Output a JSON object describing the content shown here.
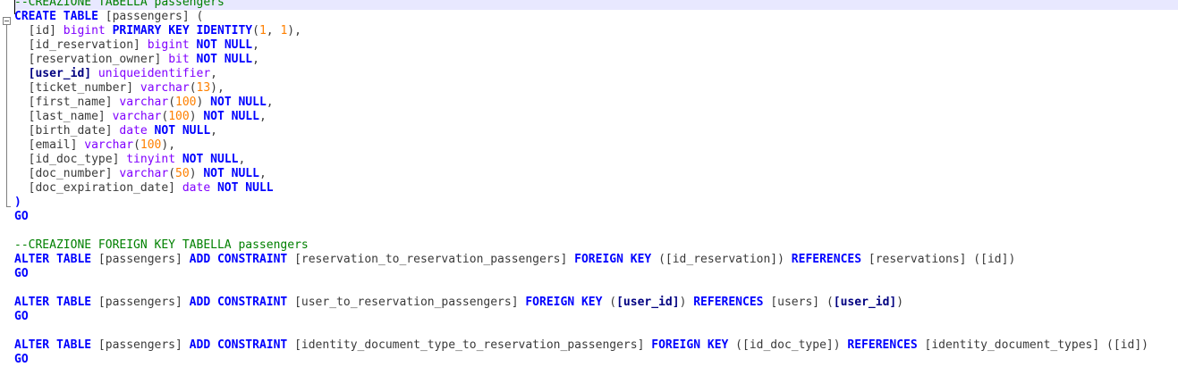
{
  "editor": {
    "colors": {
      "keyword": "#0000ff",
      "type": "#8000ff",
      "number": "#ff8000",
      "comment": "#008000",
      "identifier_bold": "#000080",
      "current_line": "#e8e8ff"
    },
    "lines": [
      [
        {
          "t": "cmt",
          "v": "--CREAZIONE TABELLA passengers"
        }
      ],
      [
        {
          "t": "kw",
          "v": "CREATE TABLE"
        },
        {
          "t": "pl",
          "v": " [passengers] ("
        }
      ],
      [
        {
          "t": "pl",
          "v": "  [id] "
        },
        {
          "t": "ty",
          "v": "bigint"
        },
        {
          "t": "pl",
          "v": " "
        },
        {
          "t": "kw",
          "v": "PRIMARY KEY IDENTITY"
        },
        {
          "t": "pl",
          "v": "("
        },
        {
          "t": "num",
          "v": "1"
        },
        {
          "t": "pl",
          "v": ", "
        },
        {
          "t": "num",
          "v": "1"
        },
        {
          "t": "pl",
          "v": "),"
        }
      ],
      [
        {
          "t": "pl",
          "v": "  [id_reservation] "
        },
        {
          "t": "ty",
          "v": "bigint"
        },
        {
          "t": "pl",
          "v": " "
        },
        {
          "t": "kw",
          "v": "NOT NULL"
        },
        {
          "t": "pl",
          "v": ","
        }
      ],
      [
        {
          "t": "pl",
          "v": "  [reservation_owner] "
        },
        {
          "t": "ty",
          "v": "bit"
        },
        {
          "t": "pl",
          "v": " "
        },
        {
          "t": "kw",
          "v": "NOT NULL"
        },
        {
          "t": "pl",
          "v": ","
        }
      ],
      [
        {
          "t": "id",
          "v": "  [user_id]"
        },
        {
          "t": "pl",
          "v": " "
        },
        {
          "t": "ty",
          "v": "uniqueidentifier"
        },
        {
          "t": "pl",
          "v": ","
        }
      ],
      [
        {
          "t": "pl",
          "v": "  [ticket_number] "
        },
        {
          "t": "ty",
          "v": "varchar"
        },
        {
          "t": "pl",
          "v": "("
        },
        {
          "t": "num",
          "v": "13"
        },
        {
          "t": "pl",
          "v": "),"
        }
      ],
      [
        {
          "t": "pl",
          "v": "  [first_name] "
        },
        {
          "t": "ty",
          "v": "varchar"
        },
        {
          "t": "pl",
          "v": "("
        },
        {
          "t": "num",
          "v": "100"
        },
        {
          "t": "pl",
          "v": ") "
        },
        {
          "t": "kw",
          "v": "NOT NULL"
        },
        {
          "t": "pl",
          "v": ","
        }
      ],
      [
        {
          "t": "pl",
          "v": "  [last_name] "
        },
        {
          "t": "ty",
          "v": "varchar"
        },
        {
          "t": "pl",
          "v": "("
        },
        {
          "t": "num",
          "v": "100"
        },
        {
          "t": "pl",
          "v": ") "
        },
        {
          "t": "kw",
          "v": "NOT NULL"
        },
        {
          "t": "pl",
          "v": ","
        }
      ],
      [
        {
          "t": "pl",
          "v": "  [birth_date] "
        },
        {
          "t": "ty",
          "v": "date"
        },
        {
          "t": "pl",
          "v": " "
        },
        {
          "t": "kw",
          "v": "NOT NULL"
        },
        {
          "t": "pl",
          "v": ","
        }
      ],
      [
        {
          "t": "pl",
          "v": "  [email] "
        },
        {
          "t": "ty",
          "v": "varchar"
        },
        {
          "t": "pl",
          "v": "("
        },
        {
          "t": "num",
          "v": "100"
        },
        {
          "t": "pl",
          "v": "),"
        }
      ],
      [
        {
          "t": "pl",
          "v": "  [id_doc_type] "
        },
        {
          "t": "ty",
          "v": "tinyint"
        },
        {
          "t": "pl",
          "v": " "
        },
        {
          "t": "kw",
          "v": "NOT NULL"
        },
        {
          "t": "pl",
          "v": ","
        }
      ],
      [
        {
          "t": "pl",
          "v": "  [doc_number] "
        },
        {
          "t": "ty",
          "v": "varchar"
        },
        {
          "t": "pl",
          "v": "("
        },
        {
          "t": "num",
          "v": "50"
        },
        {
          "t": "pl",
          "v": ") "
        },
        {
          "t": "kw",
          "v": "NOT NULL"
        },
        {
          "t": "pl",
          "v": ","
        }
      ],
      [
        {
          "t": "pl",
          "v": "  [doc_expiration_date] "
        },
        {
          "t": "ty",
          "v": "date"
        },
        {
          "t": "pl",
          "v": " "
        },
        {
          "t": "kw",
          "v": "NOT NULL"
        }
      ],
      [
        {
          "t": "kw",
          "v": ")"
        }
      ],
      [
        {
          "t": "kw",
          "v": "GO"
        }
      ],
      [],
      [
        {
          "t": "cmt",
          "v": "--CREAZIONE FOREIGN KEY TABELLA passengers"
        }
      ],
      [
        {
          "t": "kw",
          "v": "ALTER TABLE"
        },
        {
          "t": "pl",
          "v": " [passengers] "
        },
        {
          "t": "kw",
          "v": "ADD CONSTRAINT"
        },
        {
          "t": "pl",
          "v": " [reservation_to_reservation_passengers] "
        },
        {
          "t": "kw",
          "v": "FOREIGN KEY"
        },
        {
          "t": "pl",
          "v": " ([id_reservation]) "
        },
        {
          "t": "kw",
          "v": "REFERENCES"
        },
        {
          "t": "pl",
          "v": " [reservations] ([id])"
        }
      ],
      [
        {
          "t": "kw",
          "v": "GO"
        }
      ],
      [],
      [
        {
          "t": "kw",
          "v": "ALTER TABLE"
        },
        {
          "t": "pl",
          "v": " [passengers] "
        },
        {
          "t": "kw",
          "v": "ADD CONSTRAINT"
        },
        {
          "t": "pl",
          "v": " [user_to_reservation_passengers] "
        },
        {
          "t": "kw",
          "v": "FOREIGN KEY"
        },
        {
          "t": "pl",
          "v": " ("
        },
        {
          "t": "id",
          "v": "[user_id]"
        },
        {
          "t": "pl",
          "v": ") "
        },
        {
          "t": "kw",
          "v": "REFERENCES"
        },
        {
          "t": "pl",
          "v": " [users] ("
        },
        {
          "t": "id",
          "v": "[user_id]"
        },
        {
          "t": "pl",
          "v": ")"
        }
      ],
      [
        {
          "t": "kw",
          "v": "GO"
        }
      ],
      [],
      [
        {
          "t": "kw",
          "v": "ALTER TABLE"
        },
        {
          "t": "pl",
          "v": " [passengers] "
        },
        {
          "t": "kw",
          "v": "ADD CONSTRAINT"
        },
        {
          "t": "pl",
          "v": " [identity_document_type_to_reservation_passengers] "
        },
        {
          "t": "kw",
          "v": "FOREIGN KEY"
        },
        {
          "t": "pl",
          "v": " ([id_doc_type]) "
        },
        {
          "t": "kw",
          "v": "REFERENCES"
        },
        {
          "t": "pl",
          "v": " [identity_document_types] ([id])"
        }
      ],
      [
        {
          "t": "kw",
          "v": "GO"
        }
      ]
    ]
  }
}
